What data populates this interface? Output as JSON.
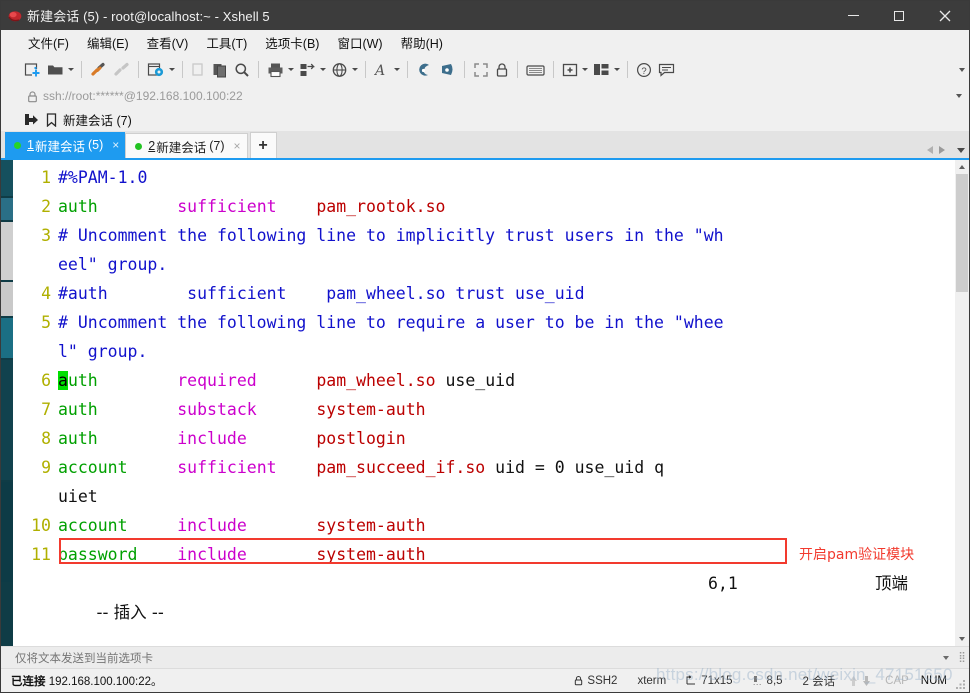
{
  "window": {
    "title": "新建会话 (5) - root@localhost:~ - Xshell 5",
    "app_icon": "xshell-logo-icon",
    "minimize_label": "—",
    "maximize_label": "□",
    "close_label": "✕"
  },
  "menubar": {
    "items": [
      {
        "label": "文件(F)",
        "name": "menu-file"
      },
      {
        "label": "编辑(E)",
        "name": "menu-edit"
      },
      {
        "label": "查看(V)",
        "name": "menu-view"
      },
      {
        "label": "工具(T)",
        "name": "menu-tools"
      },
      {
        "label": "选项卡(B)",
        "name": "menu-tab"
      },
      {
        "label": "窗口(W)",
        "name": "menu-window"
      },
      {
        "label": "帮助(H)",
        "name": "menu-help"
      }
    ]
  },
  "toolbar": {
    "icons": [
      "new-session-icon",
      "open-folder-icon",
      "connect-icon",
      "disconnect-icon",
      "properties-gear-icon",
      "copy-icon",
      "paste-icon",
      "find-icon",
      "print-icon",
      "transfer-icon",
      "browser-icon",
      "font-icon",
      "log-icon",
      "send-file-icon",
      "fullscreen-icon",
      "lock-icon",
      "keyboard-icon",
      "new-tab-icon",
      "layout-icon",
      "help-icon",
      "comment-icon"
    ],
    "overflow_label": "▾"
  },
  "address": {
    "lock_icon": "lock-icon",
    "value": "ssh://root:******@192.168.100.100:22",
    "placeholder": "ssh://root:******@192.168.100.100:22",
    "dropdown_icon": "chevron-down-icon"
  },
  "sessionbar": {
    "transfer_icon": "session-arrow-icon",
    "bookmark_icon": "bookmark-icon",
    "label": "新建会话 (7)"
  },
  "tabs": {
    "items": [
      {
        "num": "1",
        "label": "新建会话",
        "count": "(5)",
        "close": "×",
        "active": true
      },
      {
        "num": "2",
        "label": "新建会话",
        "count": "(7)",
        "close": "×",
        "active": false
      }
    ],
    "add_label": "+",
    "nav_prev_icon": "chevron-left-icon",
    "nav_next_icon": "chevron-right-icon",
    "nav_list_icon": "chevron-down-icon"
  },
  "terminal": {
    "rows": [
      {
        "ln": "1",
        "segments": [
          {
            "t": "#%PAM-1.0",
            "c": "c-cmt"
          }
        ]
      },
      {
        "ln": "2",
        "segments": [
          {
            "t": "auth",
            "c": "c-mod"
          },
          {
            "t": "        ",
            "c": "c-plain"
          },
          {
            "t": "sufficient",
            "c": "c-ctl"
          },
          {
            "t": "    ",
            "c": "c-plain"
          },
          {
            "t": "pam_rootok.so",
            "c": "c-so"
          }
        ]
      },
      {
        "ln": "3",
        "segments": [
          {
            "t": "# Uncomment the following line to implicitly trust users in the \"wh",
            "c": "c-cmt"
          }
        ]
      },
      {
        "ln": "",
        "segments": [
          {
            "t": "eel\" group.",
            "c": "c-cmt"
          }
        ]
      },
      {
        "ln": "4",
        "segments": [
          {
            "t": "#auth",
            "c": "c-cmt"
          },
          {
            "t": "        ",
            "c": "c-plain"
          },
          {
            "t": "sufficient",
            "c": "c-cmt"
          },
          {
            "t": "    ",
            "c": "c-plain"
          },
          {
            "t": "pam_wheel.so trust use_uid",
            "c": "c-cmt"
          }
        ]
      },
      {
        "ln": "5",
        "segments": [
          {
            "t": "# Uncomment the following line to require a user to be in the \"whee",
            "c": "c-cmt"
          }
        ]
      },
      {
        "ln": "",
        "segments": [
          {
            "t": "l\" group.",
            "c": "c-cmt"
          }
        ]
      },
      {
        "ln": "6",
        "segments": [
          {
            "t": "a",
            "c": "cursor"
          },
          {
            "t": "uth",
            "c": "c-mod"
          },
          {
            "t": "        ",
            "c": "c-plain"
          },
          {
            "t": "required",
            "c": "c-ctl"
          },
          {
            "t": "      ",
            "c": "c-plain"
          },
          {
            "t": "pam_wheel.so",
            "c": "c-so"
          },
          {
            "t": " use_uid",
            "c": "c-plain"
          }
        ]
      },
      {
        "ln": "7",
        "segments": [
          {
            "t": "auth",
            "c": "c-mod"
          },
          {
            "t": "        ",
            "c": "c-plain"
          },
          {
            "t": "substack",
            "c": "c-ctl"
          },
          {
            "t": "      ",
            "c": "c-plain"
          },
          {
            "t": "system-auth",
            "c": "c-so"
          }
        ]
      },
      {
        "ln": "8",
        "segments": [
          {
            "t": "auth",
            "c": "c-mod"
          },
          {
            "t": "        ",
            "c": "c-plain"
          },
          {
            "t": "include",
            "c": "c-ctl"
          },
          {
            "t": "       ",
            "c": "c-plain"
          },
          {
            "t": "postlogin",
            "c": "c-so"
          }
        ]
      },
      {
        "ln": "9",
        "segments": [
          {
            "t": "account",
            "c": "c-mod"
          },
          {
            "t": "     ",
            "c": "c-plain"
          },
          {
            "t": "sufficient",
            "c": "c-ctl"
          },
          {
            "t": "    ",
            "c": "c-plain"
          },
          {
            "t": "pam_succeed_if.so",
            "c": "c-so"
          },
          {
            "t": " uid = 0 use_uid q",
            "c": "c-plain"
          }
        ]
      },
      {
        "ln": "",
        "segments": [
          {
            "t": "uiet",
            "c": "c-plain"
          }
        ]
      },
      {
        "ln": "10",
        "segments": [
          {
            "t": "account",
            "c": "c-mod"
          },
          {
            "t": "     ",
            "c": "c-plain"
          },
          {
            "t": "include",
            "c": "c-ctl"
          },
          {
            "t": "       ",
            "c": "c-plain"
          },
          {
            "t": "system-auth",
            "c": "c-so"
          }
        ]
      },
      {
        "ln": "11",
        "segments": [
          {
            "t": "password",
            "c": "c-mod"
          },
          {
            "t": "    ",
            "c": "c-plain"
          },
          {
            "t": "include",
            "c": "c-ctl"
          },
          {
            "t": "       ",
            "c": "c-plain"
          },
          {
            "t": "system-auth",
            "c": "c-so"
          }
        ]
      }
    ],
    "vim_status": {
      "mode": "-- 插入 --",
      "position": "6,1",
      "scroll": "顶端"
    },
    "annotation": {
      "text": "开启pam验证模块",
      "color": "#f23a2e"
    },
    "scrollbar": {
      "up_icon": "scroll-up-icon",
      "down_icon": "scroll-down-icon"
    }
  },
  "sendbar": {
    "placeholder": "仅将文本发送到当前选项卡",
    "value": "",
    "dropdown_icon": "chevron-down-icon",
    "grip_icon": "resize-grip-icon"
  },
  "statusbar": {
    "connection_label": "已连接",
    "connection_target": "192.168.100.100:22。",
    "protocol_icon": "lock-icon",
    "protocol": "SSH2",
    "term_type": "xterm",
    "size_icon": "terminal-size-icon",
    "size": "71x15",
    "cursor_icon": "cursor-pos-icon",
    "cursor": "8,5",
    "sessions": "2 会话",
    "upload_icon": "upload-arrow-icon",
    "download_icon": "download-arrow-icon",
    "caps": "CAP",
    "num": "NUM",
    "grip_icon": "resize-grip-icon"
  },
  "watermark": {
    "text": "https://blog.csdn.net/weixin_47151650"
  },
  "colors": {
    "accent": "#1e9bf0",
    "titlebar": "#3c3c3c",
    "chrome": "#f0f0f0",
    "terminal_bg": "#ffffff",
    "line_number": "#b0b000",
    "comment": "#1111cc",
    "module": "#00a000",
    "control": "#cc00cc",
    "so_file": "#bb0000",
    "cursor": "#00e000",
    "annotation": "#f23a2e"
  }
}
